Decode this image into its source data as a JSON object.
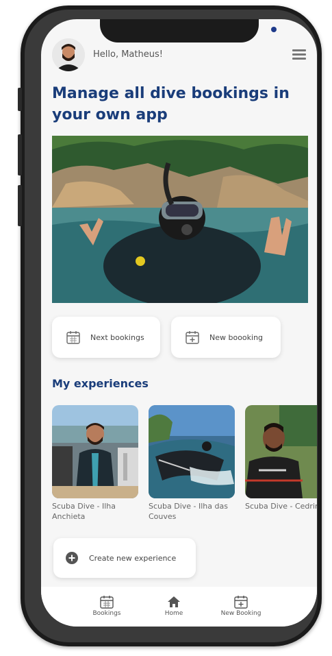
{
  "header": {
    "greeting": "Hello, Matheus!",
    "avatar_icon": "user-avatar",
    "menu_icon": "hamburger-menu-icon"
  },
  "title": "Manage all dive bookings in your own app",
  "actions": {
    "next_bookings": "Next bookings",
    "new_booking": "New boooking"
  },
  "experiences": {
    "section_title": "My experiences",
    "items": [
      {
        "caption": "Scuba Dive - Ilha Anchieta"
      },
      {
        "caption": "Scuba Dive - Ilha das Couves"
      },
      {
        "caption": "Scuba Dive - Cedrinho"
      }
    ],
    "create_label": "Create new experience"
  },
  "tabbar": {
    "bookings": "Bookings",
    "home": "Home",
    "new_booking": "New Booking"
  },
  "colors": {
    "accent": "#1a3d7a",
    "background": "#f6f6f6"
  }
}
